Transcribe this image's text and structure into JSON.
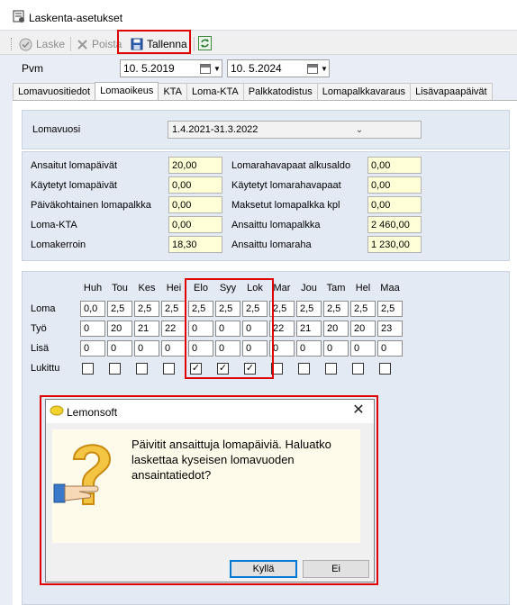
{
  "window": {
    "title": "Laskenta-asetukset"
  },
  "toolbar": {
    "calc_label": "Laske",
    "delete_label": "Poista",
    "save_label": "Tallenna"
  },
  "pvm": {
    "label": "Pvm",
    "start_date": "10.  5.2019",
    "end_date": "10.  5.2024"
  },
  "tabs": [
    "Lomavuositiedot",
    "Lomaoikeus",
    "KTA",
    "Loma-KTA",
    "Palkkatodistus",
    "Lomapalkkavaraus",
    "Lisävapaapäivät"
  ],
  "active_tab": "Lomaoikeus",
  "lomavuosi": {
    "label": "Lomavuosi",
    "value": "1.4.2021-31.3.2022"
  },
  "left_fields": [
    {
      "label": "Ansaitut lomapäivät",
      "value": "20,00"
    },
    {
      "label": "Käytetyt lomapäivät",
      "value": "0,00"
    },
    {
      "label": "Päiväkohtainen lomapalkka",
      "value": "0,00"
    },
    {
      "label": "Loma-KTA",
      "value": "0,00"
    },
    {
      "label": "Lomakerroin",
      "value": "18,30"
    }
  ],
  "right_fields": [
    {
      "label": "Lomarahavapaat alkusaldo",
      "value": "0,00"
    },
    {
      "label": "Käytetyt lomarahavapaat",
      "value": "0,00"
    },
    {
      "label": "Maksetut lomapalkka kpl",
      "value": "0,00"
    },
    {
      "label": "Ansaittu lomapalkka",
      "value": "2 460,00"
    },
    {
      "label": "Ansaittu lomaraha",
      "value": "1 230,00"
    }
  ],
  "grid": {
    "months": [
      "Huh",
      "Tou",
      "Kes",
      "Hei",
      "Elo",
      "Syy",
      "Lok",
      "Mar",
      "Jou",
      "Tam",
      "Hel",
      "Maa"
    ],
    "rows": [
      {
        "label": "Loma",
        "values": [
          "0,0",
          "2,5",
          "2,5",
          "2,5",
          "2,5",
          "2,5",
          "2,5",
          "2,5",
          "2,5",
          "2,5",
          "2,5",
          "2,5"
        ]
      },
      {
        "label": "Työ",
        "values": [
          "0",
          "20",
          "21",
          "22",
          "0",
          "0",
          "0",
          "22",
          "21",
          "20",
          "20",
          "23"
        ]
      },
      {
        "label": "Lisä",
        "values": [
          "0",
          "0",
          "0",
          "0",
          "0",
          "0",
          "0",
          "0",
          "0",
          "0",
          "0",
          "0"
        ]
      }
    ],
    "locked_label": "Lukittu",
    "locked": [
      false,
      false,
      false,
      false,
      true,
      true,
      true,
      false,
      false,
      false,
      false,
      false
    ]
  },
  "dialog": {
    "title": "Lemonsoft",
    "message": "Päivitit ansaittuja lomapäiviä. Haluatko laskettaa kyseisen lomavuoden ansaintatiedot?",
    "yes_label": "Kyllä",
    "no_label": "Ei"
  },
  "colors": {
    "highlight": "#e00000",
    "field_yellow": "#ffffd8",
    "group_bg": "#e3eaf4",
    "dialog_msg_bg": "#fffbea"
  }
}
